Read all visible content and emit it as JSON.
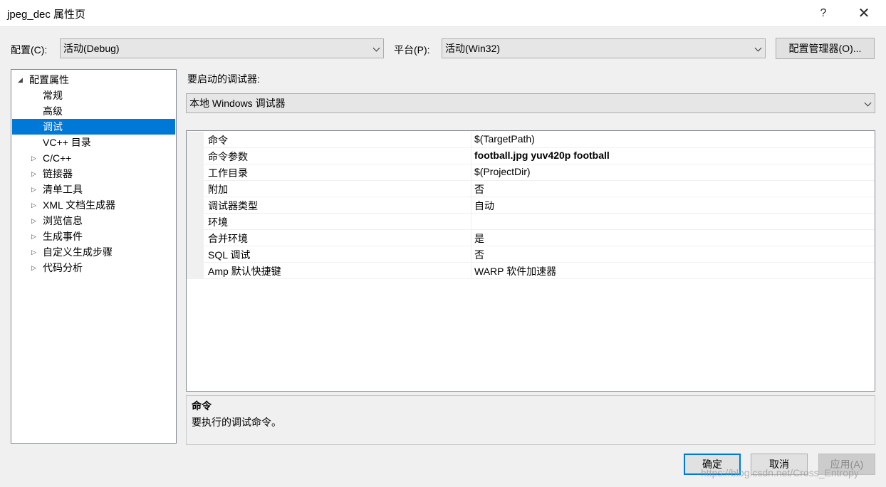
{
  "window": {
    "title": "jpeg_dec 属性页",
    "help": "?",
    "close": "✕"
  },
  "config": {
    "label": "配置(C):",
    "value": "活动(Debug)",
    "platform_label": "平台(P):",
    "platform_value": "活动(Win32)",
    "manager_button": "配置管理器(O)..."
  },
  "tree": {
    "items": [
      {
        "label": "配置属性",
        "arrow": "◢"
      },
      {
        "label": "常规"
      },
      {
        "label": "高级"
      },
      {
        "label": "调试"
      },
      {
        "label": "VC++ 目录"
      },
      {
        "label": "C/C++",
        "arrow": "▷"
      },
      {
        "label": "链接器",
        "arrow": "▷"
      },
      {
        "label": "清单工具",
        "arrow": "▷"
      },
      {
        "label": "XML 文档生成器",
        "arrow": "▷"
      },
      {
        "label": "浏览信息",
        "arrow": "▷"
      },
      {
        "label": "生成事件",
        "arrow": "▷"
      },
      {
        "label": "自定义生成步骤",
        "arrow": "▷"
      },
      {
        "label": "代码分析",
        "arrow": "▷"
      }
    ],
    "selected": "调试"
  },
  "debugger": {
    "label": "要启动的调试器:",
    "value": "本地 Windows 调试器"
  },
  "properties": [
    {
      "name": "命令",
      "value": "$(TargetPath)"
    },
    {
      "name": "命令参数",
      "value": "football.jpg yuv420p football",
      "bold": true
    },
    {
      "name": "工作目录",
      "value": "$(ProjectDir)"
    },
    {
      "name": "附加",
      "value": "否"
    },
    {
      "name": "调试器类型",
      "value": "自动"
    },
    {
      "name": "环境",
      "value": ""
    },
    {
      "name": "合并环境",
      "value": "是"
    },
    {
      "name": "SQL 调试",
      "value": "否"
    },
    {
      "name": "Amp 默认快捷键",
      "value": "WARP 软件加速器"
    }
  ],
  "description": {
    "title": "命令",
    "text": "要执行的调试命令。"
  },
  "buttons": {
    "ok": "确定",
    "cancel": "取消",
    "apply": "应用(A)"
  },
  "watermark": "https://blog.csdn.net/Cross_Entropy"
}
